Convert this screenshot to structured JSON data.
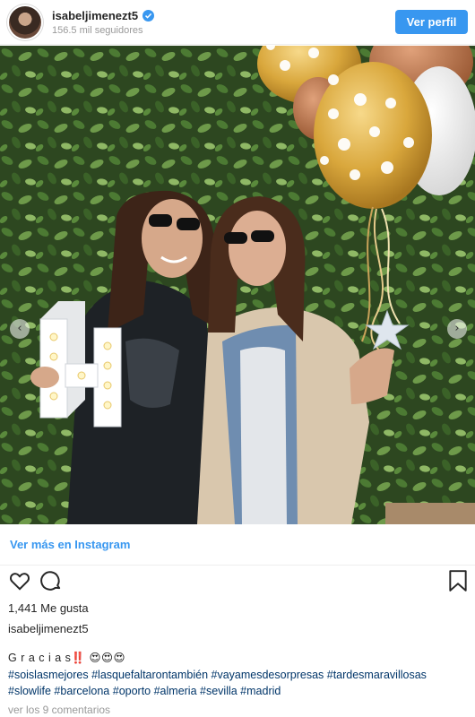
{
  "header": {
    "username": "isabeljimenezt5",
    "followers": "156.5 mil seguidores",
    "follow_button": "Ver perfil"
  },
  "photo": {
    "prev_arrow": "‹",
    "next_arrow": "›"
  },
  "links": {
    "see_more": "Ver más en Instagram"
  },
  "post": {
    "likes": "1,441 Me gusta",
    "owner": "isabeljimenezt5",
    "caption": "G r a c i a s‼️ 😍😍😍",
    "hashtags": "#soislasmejores #lasquefaltarontambién #vayamesdesorpresas #tardesmaravillosas #slowlife #barcelona #oporto #almeria #sevilla #madrid",
    "comments_link": "ver los 9 comentarios"
  },
  "colors": {
    "accent": "#3897f0",
    "hashtag": "#003569",
    "muted": "#999999"
  }
}
